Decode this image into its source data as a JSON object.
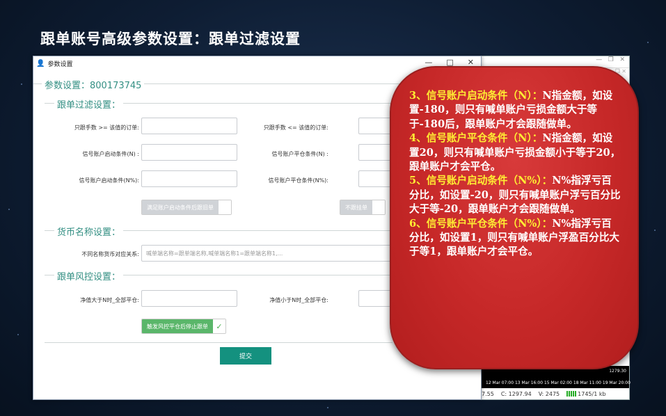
{
  "slide": {
    "title": "跟单账号高级参数设置：跟单过滤设置"
  },
  "dialog": {
    "title": "参数设置",
    "account_label": "参数设置：800173745",
    "sections": {
      "filter": "跟单过滤设置：",
      "currency": "货币名称设置：",
      "risk": "跟单风控设置："
    },
    "fields": {
      "min_lots": "只跟手数 >= 该值的订单:",
      "max_lots": "只跟手数 <= 该值的订单:",
      "start_cond_n": "信号账户启动条件(N)  :",
      "close_cond_n": "信号账户平仓条件(N)  :",
      "start_cond_pct": "信号账户启动条件(N%):",
      "close_cond_pct": "信号账户平仓条件(N%):",
      "currency_map": "不同名称货币对应关系:",
      "equity_above": "净值大于N时_全部平仓:",
      "equity_below": "净值小于N时_全部平仓:"
    },
    "currency_placeholder": "喊单端名称=跟单端名称,喊单端名称1=跟单端名称1,...",
    "toggles": {
      "follow_old": "满足账户启动条件后跟旧单",
      "no_pending": "不跟挂单",
      "risk_stop": "触发风控平仓后停止跟单"
    },
    "submit_label": "提交",
    "window_buttons": {
      "minimize": "—",
      "maximize": "□",
      "close": "✕"
    }
  },
  "background_window": {
    "price": "1279.30",
    "times": "12 Mar 07:00  13 Mar 16:00  15 Mar 02:00  18 Mar 11:00  19 Mar 20:00",
    "status": {
      "left": "7.55",
      "c": "C: 1297.94",
      "v": "V: 2475",
      "traffic": "1745/1 kb"
    }
  },
  "callout": {
    "items": [
      {
        "head": "3、信号账户启动条件（N）：",
        "body": "N指金额，如设置-180，则只有喊单账户亏损金额大于等于-180后，跟单账户才会跟随做单。"
      },
      {
        "head": "4、信号账户平仓条件（N）：",
        "body": "N指金额，如设置20，则只有喊单账户亏损金额小于等于20，跟单账户才会平仓。"
      },
      {
        "head": "5、信号账户启动条件（N%）：",
        "body": "N%指浮亏百分比，如设置-20，则只有喊单账户浮亏百分比大于等-20，跟单账户才会跟随做单。"
      },
      {
        "head": "6、信号账户平仓条件（N%）：",
        "body": "N%指浮亏百分比，如设置1，则只有喊单账户浮盈百分比大于等1，跟单账户才会平仓。"
      }
    ]
  },
  "colors": {
    "accent": "#14917f",
    "callout": "#c62828",
    "highlight": "#ffee33",
    "toggle_on": "#5ab66a"
  }
}
